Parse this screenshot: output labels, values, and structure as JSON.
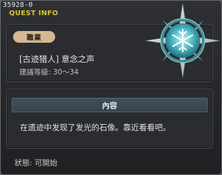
{
  "window": {
    "quest_id": "35928-0",
    "title": "QUEST INFO"
  },
  "job": {
    "badge_label": "職業",
    "name": "[古迹猎人] 意念之声",
    "level_range": "建議等級: 30〜34"
  },
  "content": {
    "header_label": "內容",
    "text": "在遗迹中发现了发光的石像。靠近看看吧。"
  },
  "status": {
    "text": "狀態:  可開始"
  },
  "icons": {
    "emblem": "compass-emblem-icon"
  },
  "colors": {
    "title_accent": "#d9c62f",
    "badge_bg": "#d5b891",
    "header_bg": "#3f505a"
  }
}
